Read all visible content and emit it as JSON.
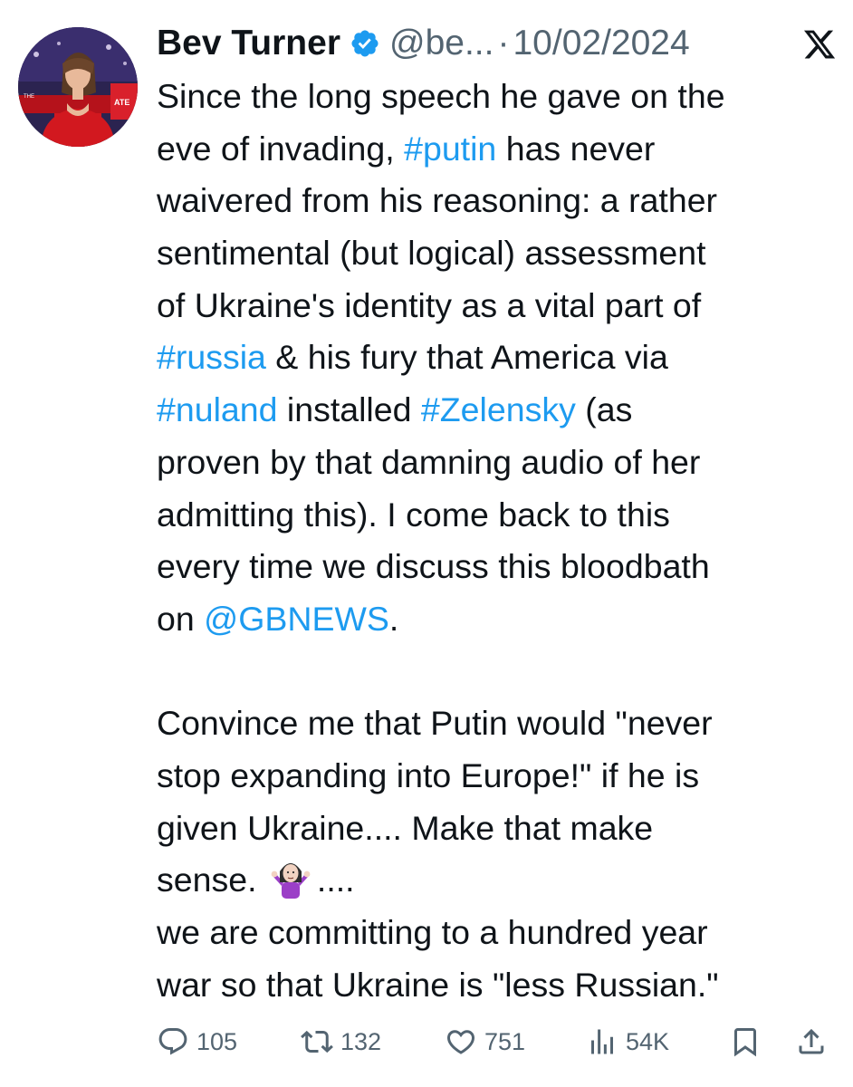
{
  "author": {
    "name": "Bev Turner",
    "handle": "@be...",
    "separator": "·",
    "date": "10/02/2024"
  },
  "tweet": {
    "lines": [
      [
        {
          "t": "Since the long speech he gave on the",
          "link": false
        }
      ],
      [
        {
          "t": "eve of invading, ",
          "link": false
        },
        {
          "t": "#putin",
          "link": true
        },
        {
          "t": " has never",
          "link": false
        }
      ],
      [
        {
          "t": "waivered from his reasoning: a rather",
          "link": false
        }
      ],
      [
        {
          "t": "sentimental (but logical) assessment",
          "link": false
        }
      ],
      [
        {
          "t": "of Ukraine's identity as a vital part of",
          "link": false
        }
      ],
      [
        {
          "t": "#russia",
          "link": true
        },
        {
          "t": " & his fury that America via",
          "link": false
        }
      ],
      [
        {
          "t": "#nuland",
          "link": true
        },
        {
          "t": " installed ",
          "link": false
        },
        {
          "t": "#Zelensky",
          "link": true
        },
        {
          "t": " (as",
          "link": false
        }
      ],
      [
        {
          "t": "proven by that damning audio of her",
          "link": false
        }
      ],
      [
        {
          "t": "admitting this). I come back to this",
          "link": false
        }
      ],
      [
        {
          "t": "every time we discuss this bloodbath",
          "link": false
        }
      ],
      [
        {
          "t": "on ",
          "link": false
        },
        {
          "t": "@GBNEWS",
          "link": true
        },
        {
          "t": ".",
          "link": false
        }
      ],
      [],
      [
        {
          "t": "Convince me that Putin would \"never",
          "link": false
        }
      ],
      [
        {
          "t": "stop expanding into Europe!\" if he is",
          "link": false
        }
      ],
      [
        {
          "t": "given Ukraine.... Make that make",
          "link": false
        }
      ],
      [
        {
          "t": "sense. ",
          "link": false
        },
        {
          "emoji": "person-shrugging-emoji"
        },
        {
          "t": "....",
          "link": false
        }
      ],
      [
        {
          "t": " we are committing to a hundred year",
          "link": false
        }
      ],
      [
        {
          "t": "war so that Ukraine is \"less Russian.\"",
          "link": false
        }
      ]
    ]
  },
  "metrics": {
    "replies": "105",
    "reposts": "132",
    "likes": "751",
    "views": "54K"
  },
  "icons": {
    "verified": "verified-badge-icon",
    "brand": "x-logo-icon",
    "reply": "reply-icon",
    "repost": "repost-icon",
    "like": "heart-icon",
    "views": "views-icon",
    "bookmark": "bookmark-icon",
    "share": "share-icon"
  },
  "colors": {
    "text": "#0f1419",
    "secondary": "#536471",
    "link": "#1d9bf0",
    "verified": "#1d9bf0"
  }
}
